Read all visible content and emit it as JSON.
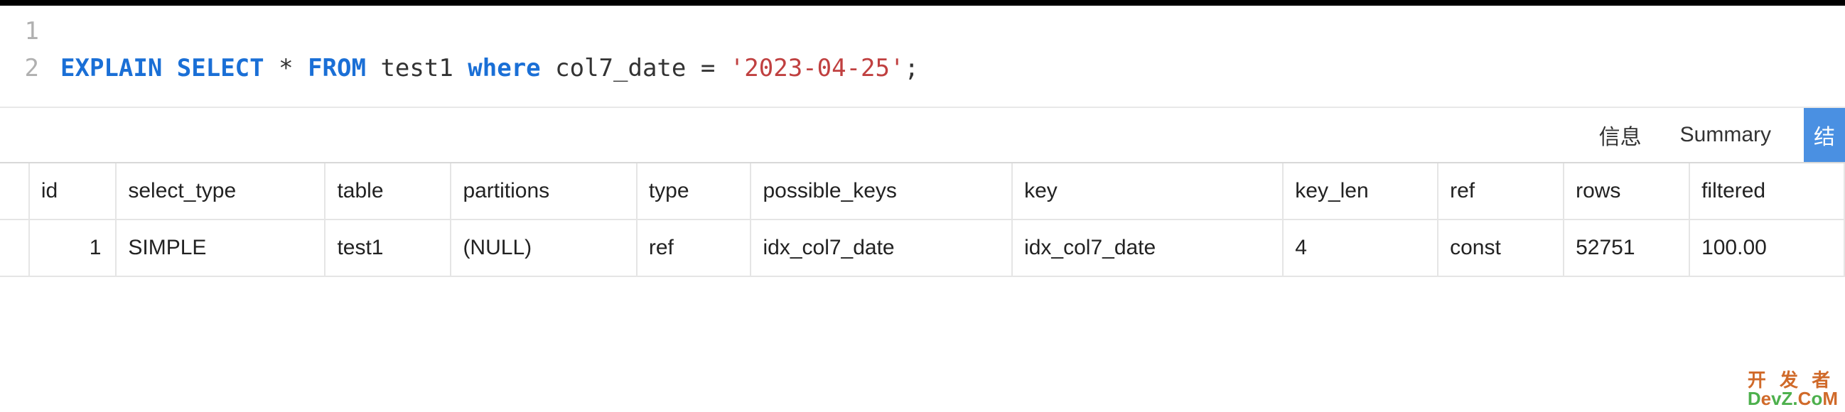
{
  "editor": {
    "lines": {
      "1": "",
      "2": {
        "explain": "EXPLAIN",
        "select": "SELECT",
        "star": "*",
        "from": "FROM",
        "table": "test1",
        "where": "where",
        "col": "col7_date",
        "eq": "=",
        "str": "'2023-04-25'",
        "semi": ";"
      }
    },
    "line_numbers": {
      "l1": "1",
      "l2": "2"
    }
  },
  "tabs": {
    "info": "信息",
    "summary": "Summary",
    "result": "结"
  },
  "table": {
    "headers": {
      "id": "id",
      "select_type": "select_type",
      "table": "table",
      "partitions": "partitions",
      "type": "type",
      "possible_keys": "possible_keys",
      "key": "key",
      "key_len": "key_len",
      "ref": "ref",
      "rows": "rows",
      "filtered": "filtered"
    },
    "rows": [
      {
        "id": "1",
        "select_type": "SIMPLE",
        "table": "test1",
        "partitions": "(NULL)",
        "type": "ref",
        "possible_keys": "idx_col7_date",
        "key": "idx_col7_date",
        "key_len": "4",
        "ref": "const",
        "rows": "52751",
        "filtered": "100.00"
      }
    ]
  },
  "watermark": {
    "top": "开 发 者",
    "bottom": "DevZ.CoM"
  }
}
